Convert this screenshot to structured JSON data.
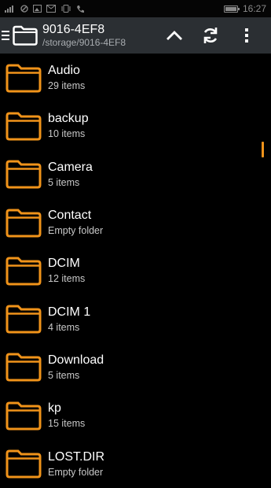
{
  "status_bar": {
    "time": "16:27",
    "battery_level": 0.85
  },
  "toolbar": {
    "title": "9016-4EF8",
    "path": "/storage/9016-4EF8"
  },
  "folders": [
    {
      "name": "Audio",
      "count": "29 items"
    },
    {
      "name": "backup",
      "count": "10 items"
    },
    {
      "name": "Camera",
      "count": "5 items"
    },
    {
      "name": "Contact",
      "count": "Empty folder"
    },
    {
      "name": "DCIM",
      "count": "12 items"
    },
    {
      "name": "DCIM 1",
      "count": "4 items"
    },
    {
      "name": "Download",
      "count": "5 items"
    },
    {
      "name": "kp",
      "count": "15 items"
    },
    {
      "name": "LOST.DIR",
      "count": "Empty folder"
    }
  ],
  "colors": {
    "accent": "#f0931a",
    "toolbar_bg": "#2b2f33",
    "background": "#000000"
  },
  "icons": [
    "menu-icon",
    "folder-icon",
    "chevron-up-icon",
    "refresh-icon",
    "overflow-menu-icon"
  ]
}
